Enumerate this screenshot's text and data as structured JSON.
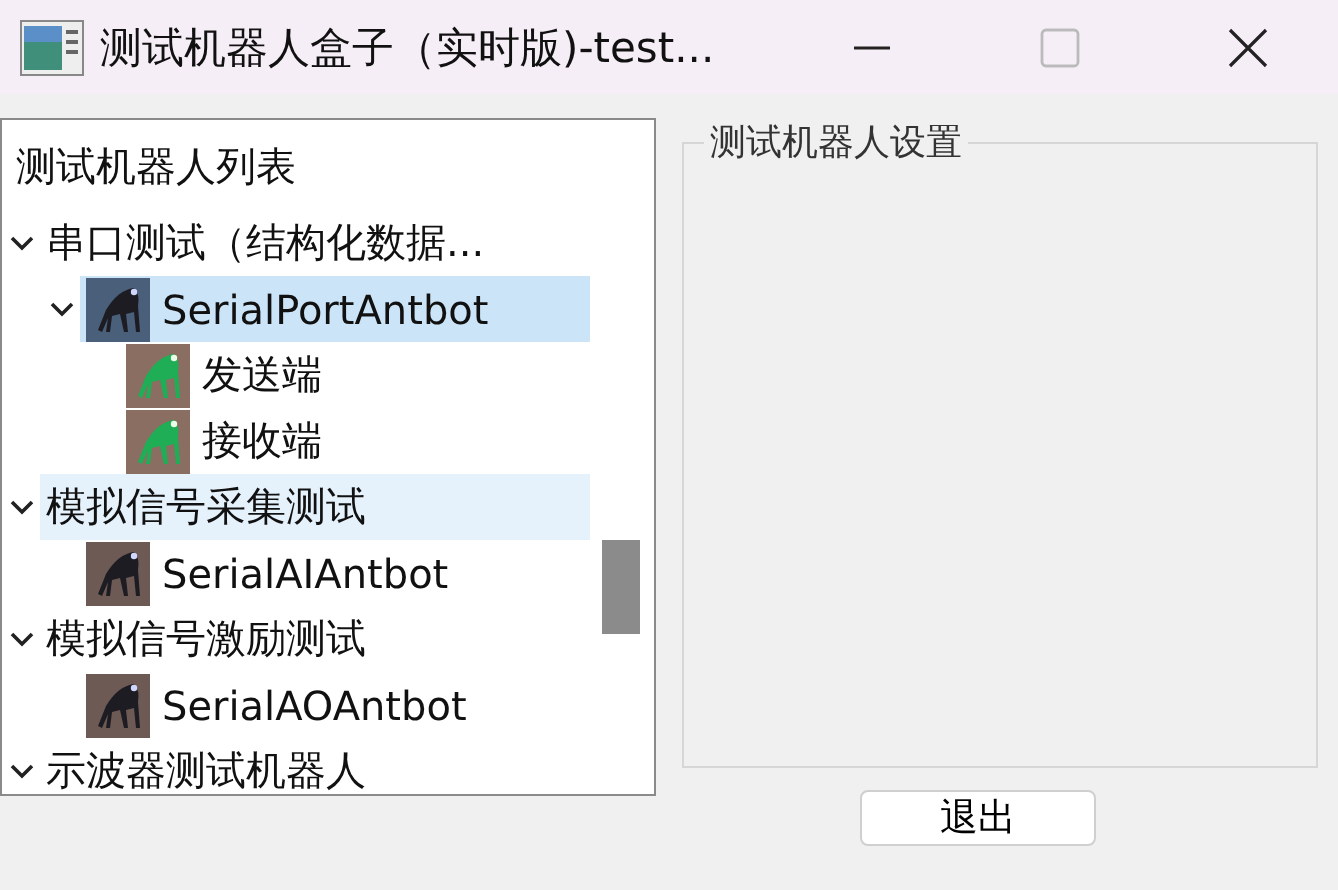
{
  "window": {
    "title": "测试机器人盒子（实时版)-test..."
  },
  "tree": {
    "header": "测试机器人列表",
    "items": [
      {
        "label": "串口测试（结构化数据...",
        "expanded": true,
        "selected": false,
        "hovered": false,
        "children": [
          {
            "label": "SerialPortAntbot",
            "kind": "robot",
            "expanded": true,
            "selected": true,
            "hovered": false,
            "children": [
              {
                "label": "发送端",
                "kind": "endpoint",
                "selected": false,
                "hovered": false
              },
              {
                "label": "接收端",
                "kind": "endpoint",
                "selected": false,
                "hovered": false
              }
            ]
          }
        ]
      },
      {
        "label": "模拟信号采集测试",
        "expanded": true,
        "selected": false,
        "hovered": true,
        "children": [
          {
            "label": "SerialAIAntbot",
            "kind": "robot",
            "selected": false,
            "hovered": false
          }
        ]
      },
      {
        "label": "模拟信号激励测试",
        "expanded": true,
        "selected": false,
        "hovered": false,
        "children": [
          {
            "label": "SerialAOAntbot",
            "kind": "robot",
            "selected": false,
            "hovered": false
          }
        ]
      },
      {
        "label": "示波器测试机器人",
        "expanded": true,
        "selected": false,
        "hovered": false
      }
    ]
  },
  "settings": {
    "title": "测试机器人设置"
  },
  "buttons": [
    {
      "label": "退出"
    }
  ]
}
